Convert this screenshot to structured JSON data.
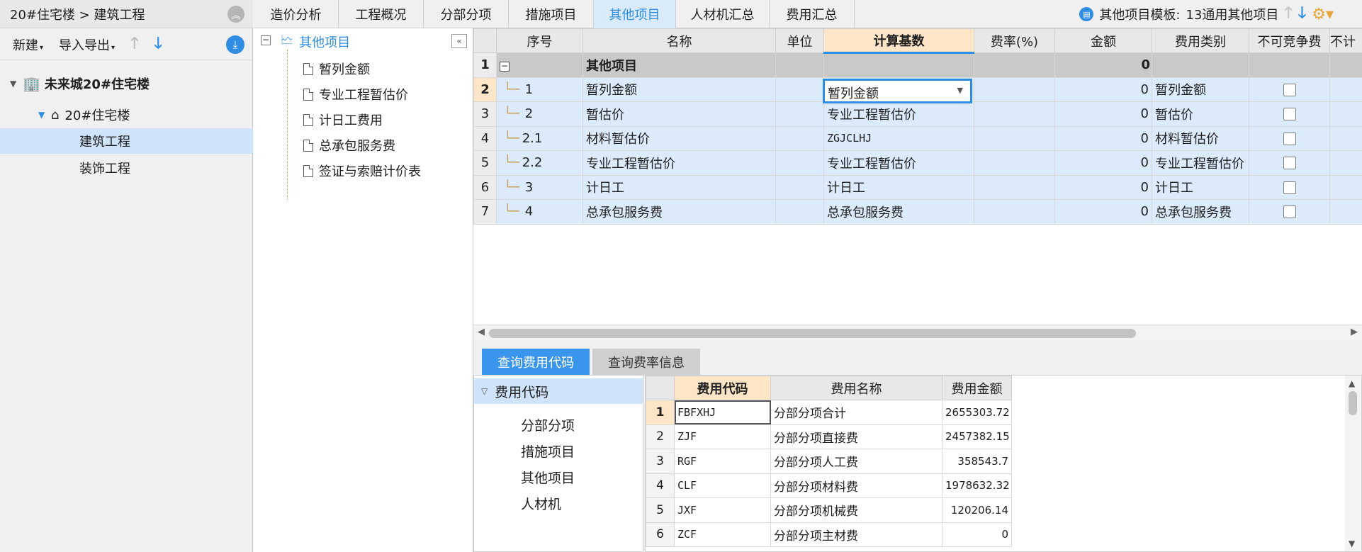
{
  "breadcrumb": "20#住宅楼 > 建筑工程",
  "left_toolbar": {
    "new_label": "新建",
    "io_label": "导入导出"
  },
  "project_tree": {
    "root": "未来城20#住宅楼",
    "building": "20#住宅楼",
    "items": [
      "建筑工程",
      "装饰工程"
    ]
  },
  "tabs": [
    "造价分析",
    "工程概况",
    "分部分项",
    "措施项目",
    "其他项目",
    "人材机汇总",
    "费用汇总"
  ],
  "active_tab": "其他项目",
  "template": {
    "label": "其他项目模板:",
    "value": "13通用其他项目"
  },
  "other_tree": {
    "root": "其他项目",
    "children": [
      "暂列金额",
      "专业工程暂估价",
      "计日工费用",
      "总承包服务费",
      "签证与索赔计价表"
    ]
  },
  "grid": {
    "headers": [
      "序号",
      "名称",
      "单位",
      "计算基数",
      "费率(%)",
      "金额",
      "费用类别",
      "不可竞争费",
      "不计"
    ],
    "rows": [
      {
        "rn": "1",
        "seq": "",
        "name": "其他项目",
        "unit": "",
        "base": "",
        "rate": "",
        "amount": "0",
        "type": ""
      },
      {
        "rn": "2",
        "seq": "1",
        "name": "暂列金额",
        "unit": "",
        "base": "暂列金额",
        "rate": "",
        "amount": "0",
        "type": "暂列金额"
      },
      {
        "rn": "3",
        "seq": "2",
        "name": "暂估价",
        "unit": "",
        "base": "专业工程暂估价",
        "rate": "",
        "amount": "0",
        "type": "暂估价"
      },
      {
        "rn": "4",
        "seq": "2.1",
        "name": "材料暂估价",
        "unit": "",
        "base": "ZGJCLHJ",
        "rate": "",
        "amount": "0",
        "type": "材料暂估价"
      },
      {
        "rn": "5",
        "seq": "2.2",
        "name": "专业工程暂估价",
        "unit": "",
        "base": "专业工程暂估价",
        "rate": "",
        "amount": "0",
        "type": "专业工程暂估价"
      },
      {
        "rn": "6",
        "seq": "3",
        "name": "计日工",
        "unit": "",
        "base": "计日工",
        "rate": "",
        "amount": "0",
        "type": "计日工"
      },
      {
        "rn": "7",
        "seq": "4",
        "name": "总承包服务费",
        "unit": "",
        "base": "总承包服务费",
        "rate": "",
        "amount": "0",
        "type": "总承包服务费"
      }
    ]
  },
  "query": {
    "tab_codes": "查询费用代码",
    "tab_rates": "查询费率信息",
    "tree_header": "费用代码",
    "tree_items": [
      "分部分项",
      "措施项目",
      "其他项目",
      "人材机"
    ],
    "headers": [
      "费用代码",
      "费用名称",
      "费用金额"
    ],
    "rows": [
      {
        "rn": "1",
        "code": "FBFXHJ",
        "name": "分部分项合计",
        "amount": "2655303.72"
      },
      {
        "rn": "2",
        "code": "ZJF",
        "name": "分部分项直接费",
        "amount": "2457382.15"
      },
      {
        "rn": "3",
        "code": "RGF",
        "name": "分部分项人工费",
        "amount": "358543.7"
      },
      {
        "rn": "4",
        "code": "CLF",
        "name": "分部分项材料费",
        "amount": "1978632.32"
      },
      {
        "rn": "5",
        "code": "JXF",
        "name": "分部分项机械费",
        "amount": "120206.14"
      },
      {
        "rn": "6",
        "code": "ZCF",
        "name": "分部分项主材费",
        "amount": "0"
      }
    ]
  }
}
